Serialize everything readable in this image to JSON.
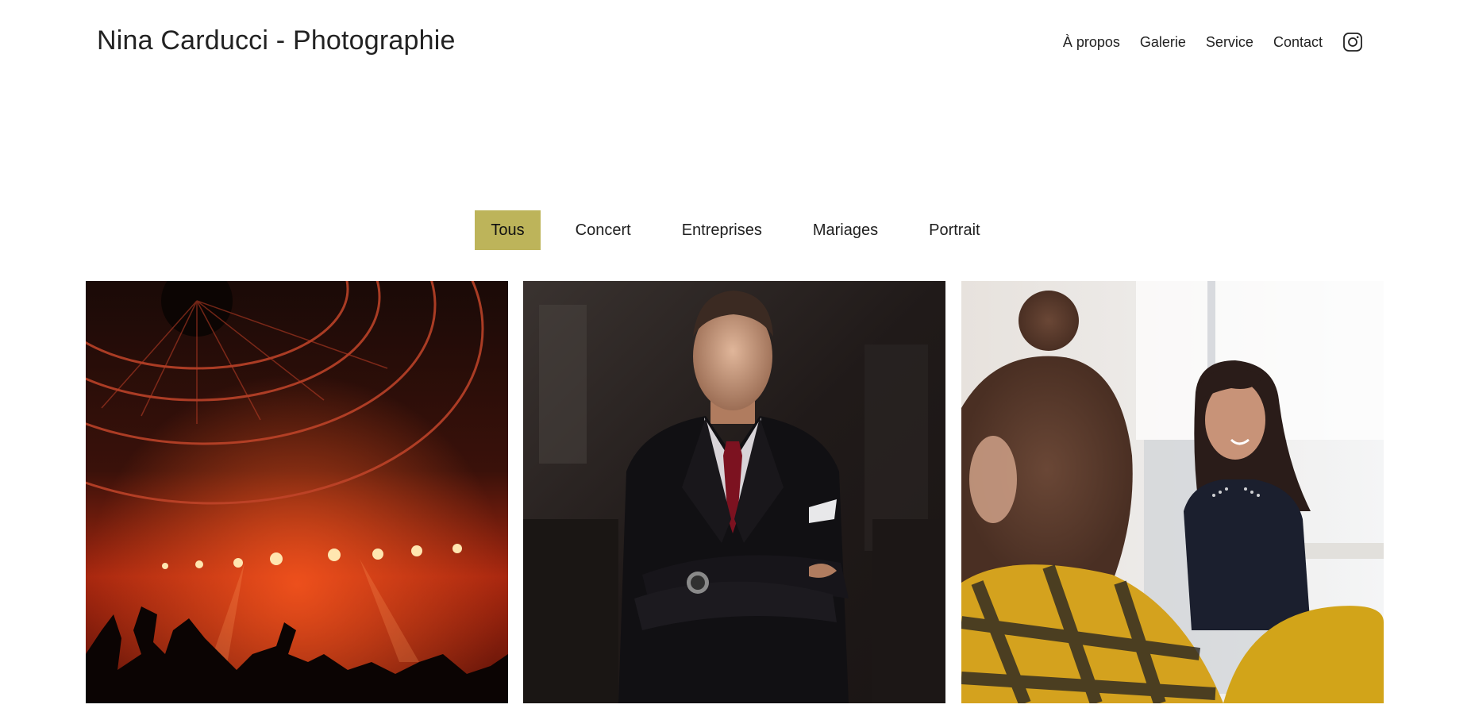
{
  "header": {
    "site_title": "Nina Carducci - Photographie",
    "nav": [
      {
        "label": "À propos"
      },
      {
        "label": "Galerie"
      },
      {
        "label": "Service"
      },
      {
        "label": "Contact"
      }
    ],
    "social_icon": "instagram-icon"
  },
  "filters": {
    "items": [
      {
        "label": "Tous",
        "active": true
      },
      {
        "label": "Concert",
        "active": false
      },
      {
        "label": "Entreprises",
        "active": false
      },
      {
        "label": "Mariages",
        "active": false
      },
      {
        "label": "Portrait",
        "active": false
      }
    ],
    "active_color": "#bdb45a"
  },
  "gallery": {
    "photos": [
      {
        "subject": "concert-photo"
      },
      {
        "subject": "businessman-portrait-photo"
      },
      {
        "subject": "office-meeting-photo"
      }
    ]
  }
}
